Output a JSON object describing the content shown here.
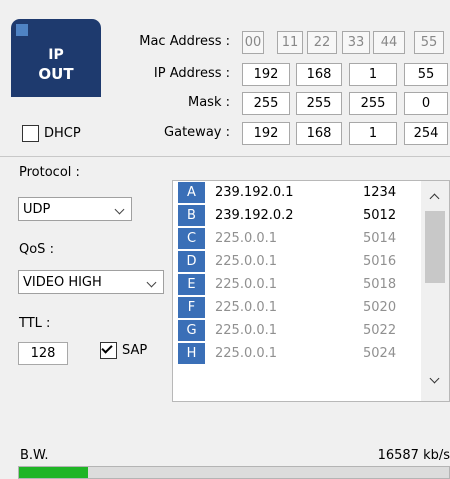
{
  "badge": {
    "line1": "IP",
    "line2": "OUT"
  },
  "network": {
    "mac_label": "Mac Address :",
    "mac_octets": [
      "00",
      "11",
      "22",
      "33",
      "44",
      "55"
    ],
    "ip_label": "IP Address :",
    "ip_octets": [
      "192",
      "168",
      "1",
      "55"
    ],
    "mask_label": "Mask :",
    "mask_octets": [
      "255",
      "255",
      "255",
      "0"
    ],
    "gateway_label": "Gateway :",
    "gateway_octets": [
      "192",
      "168",
      "1",
      "254"
    ]
  },
  "dhcp": {
    "label": "DHCP",
    "checked": false
  },
  "protocol": {
    "label": "Protocol :",
    "value": "UDP"
  },
  "qos": {
    "label": "QoS :",
    "value": "VIDEO HIGH"
  },
  "ttl": {
    "label": "TTL :",
    "value": "128"
  },
  "sap": {
    "label": "SAP",
    "checked": true
  },
  "streams": [
    {
      "letter": "A",
      "ip": "239.192.0.1",
      "port": "1234",
      "active": true
    },
    {
      "letter": "B",
      "ip": "239.192.0.2",
      "port": "5012",
      "active": true
    },
    {
      "letter": "C",
      "ip": "225.0.0.1",
      "port": "5014",
      "active": false
    },
    {
      "letter": "D",
      "ip": "225.0.0.1",
      "port": "5016",
      "active": false
    },
    {
      "letter": "E",
      "ip": "225.0.0.1",
      "port": "5018",
      "active": false
    },
    {
      "letter": "F",
      "ip": "225.0.0.1",
      "port": "5020",
      "active": false
    },
    {
      "letter": "G",
      "ip": "225.0.0.1",
      "port": "5022",
      "active": false
    },
    {
      "letter": "H",
      "ip": "225.0.0.1",
      "port": "5024",
      "active": false
    }
  ],
  "bandwidth": {
    "label": "B.W.",
    "value": "16587 kb/s",
    "fill_fraction": 0.16
  },
  "colors": {
    "badge": "#1e3a6e",
    "row_letter": "#3a6fb7",
    "bw_fill": "#1fb526"
  }
}
